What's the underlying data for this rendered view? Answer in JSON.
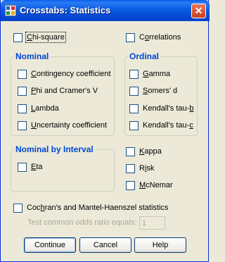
{
  "window": {
    "title": "Crosstabs: Statistics",
    "close_glyph": "✕"
  },
  "top": {
    "chi_square": {
      "pre": "",
      "u": "C",
      "post": "hi-square",
      "checked": false
    },
    "correlations": {
      "pre": "C",
      "u": "o",
      "post": "rrelations",
      "checked": false
    }
  },
  "nominal": {
    "title": "Nominal",
    "items": [
      {
        "pre": "",
        "u": "C",
        "post": "ontingency coefficient",
        "checked": false
      },
      {
        "pre": "",
        "u": "P",
        "post": "hi and Cramer's V",
        "checked": false
      },
      {
        "pre": "",
        "u": "L",
        "post": "ambda",
        "checked": false
      },
      {
        "pre": "",
        "u": "U",
        "post": "ncertainty coefficient",
        "checked": false
      }
    ]
  },
  "ordinal": {
    "title": "Ordinal",
    "items": [
      {
        "pre": "",
        "u": "G",
        "post": "amma",
        "checked": false
      },
      {
        "pre": "",
        "u": "S",
        "post": "omers' d",
        "checked": false
      },
      {
        "pre": "Kendall's tau-",
        "u": "b",
        "post": "",
        "checked": false
      },
      {
        "pre": "Kendall's tau-",
        "u": "c",
        "post": "",
        "checked": false
      }
    ]
  },
  "nominal_by_interval": {
    "title": "Nominal by Interval",
    "eta": {
      "pre": "",
      "u": "E",
      "post": "ta",
      "checked": false
    }
  },
  "extras": {
    "kappa": {
      "pre": "",
      "u": "K",
      "post": "appa",
      "checked": false
    },
    "risk": {
      "pre": "R",
      "u": "i",
      "post": "sk",
      "checked": false
    },
    "mcnemar": {
      "pre": "",
      "u": "M",
      "post": "cNemar",
      "checked": false
    }
  },
  "cmh": {
    "label": {
      "pre": "Coc",
      "u": "h",
      "post": "ran's and Mantel-Haenszel statistics",
      "checked": false
    },
    "odds_label": "Test common odds ratio equals:",
    "odds_value": "1"
  },
  "buttons": {
    "continue": "Continue",
    "cancel": "Cancel",
    "help": "Help"
  },
  "colors": {
    "title_bar": "#0a5ce0",
    "group_title": "#0046d5",
    "window_bg": "#ece9d8"
  }
}
